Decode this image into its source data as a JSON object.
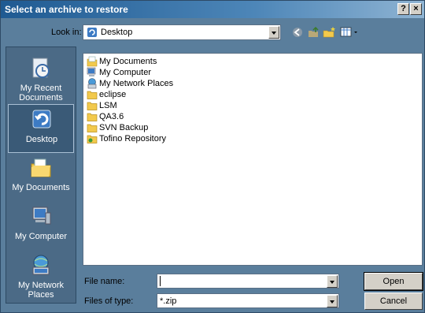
{
  "window": {
    "title": "Select an archive to restore",
    "help_label": "?",
    "close_label": "×"
  },
  "look_in": {
    "label": "Look in:",
    "value": "Desktop"
  },
  "toolbar": {
    "back_icon": "back-icon",
    "up_icon": "up-folder-icon",
    "new_folder_icon": "new-folder-icon",
    "views_icon": "views-menu-icon"
  },
  "places": [
    {
      "label": "My Recent Documents",
      "icon": "recent-documents-icon"
    },
    {
      "label": "Desktop",
      "icon": "desktop-icon"
    },
    {
      "label": "My Documents",
      "icon": "my-documents-icon"
    },
    {
      "label": "My Computer",
      "icon": "my-computer-icon"
    },
    {
      "label": "My Network Places",
      "icon": "network-places-icon"
    }
  ],
  "files": [
    {
      "name": "My Documents",
      "icon": "my-documents-icon"
    },
    {
      "name": "My Computer",
      "icon": "my-computer-icon"
    },
    {
      "name": "My Network Places",
      "icon": "network-places-icon"
    },
    {
      "name": "eclipse",
      "icon": "folder-icon"
    },
    {
      "name": "LSM",
      "icon": "folder-icon"
    },
    {
      "name": "QA3.6",
      "icon": "folder-icon"
    },
    {
      "name": "SVN Backup",
      "icon": "folder-icon"
    },
    {
      "name": "Tofino Repository",
      "icon": "shared-folder-icon"
    }
  ],
  "file_name": {
    "label": "File name:",
    "value": ""
  },
  "file_type": {
    "label": "Files of type:",
    "value": "*.zip"
  },
  "buttons": {
    "open": "Open",
    "cancel": "Cancel"
  },
  "colors": {
    "title_bar": "#1f5a92",
    "places_bar": "#4b6a86",
    "dialog_bg": "#5a7e9c"
  }
}
